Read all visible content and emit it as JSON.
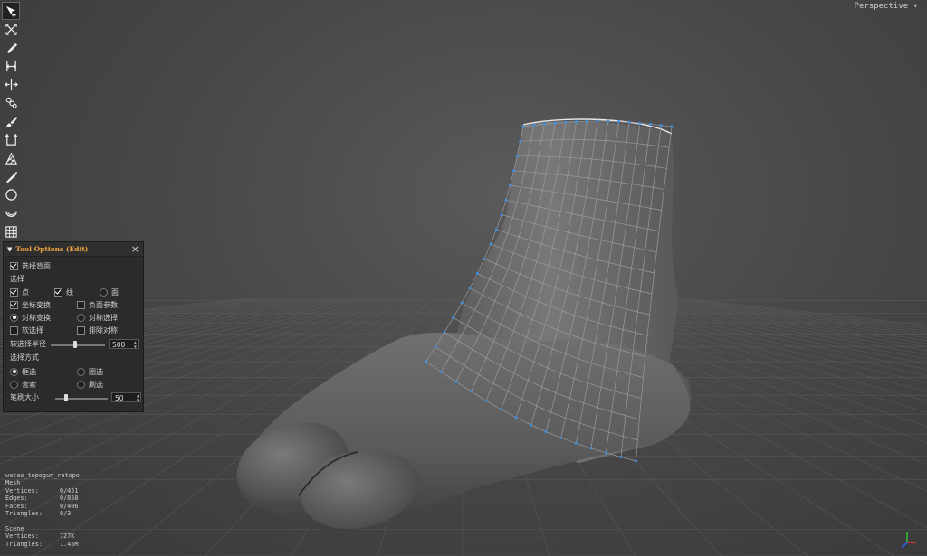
{
  "viewport": {
    "camera_label": "Perspective",
    "camera_dropdown_icon": "caret-down-icon",
    "background_colors": [
      "#5a5a5a",
      "#383838"
    ],
    "mesh_color": "#6a6a6a",
    "wire_color": "#9a9a9a",
    "vertex_color": "#3d8fe0"
  },
  "toolbar": {
    "tools": [
      {
        "name": "select-tool",
        "icon": "arrow-select-icon",
        "active": true
      },
      {
        "name": "transform-tool",
        "icon": "cross-arrows-icon"
      },
      {
        "name": "pen-tool",
        "icon": "pen-icon"
      },
      {
        "name": "bridge-tool",
        "icon": "bridge-icon"
      },
      {
        "name": "slide-tool",
        "icon": "slide-arrows-icon"
      },
      {
        "name": "loop-tool",
        "icon": "loop-rings-icon"
      },
      {
        "name": "brush-tool",
        "icon": "brush-icon"
      },
      {
        "name": "extend-tool",
        "icon": "extend-edge-icon"
      },
      {
        "name": "fill-tool",
        "icon": "fill-patch-icon"
      },
      {
        "name": "knife-tool",
        "icon": "knife-icon"
      },
      {
        "name": "circle-tool",
        "icon": "circle-icon"
      },
      {
        "name": "relax-tool",
        "icon": "cup-curve-icon"
      },
      {
        "name": "grid-tool",
        "icon": "grid-icon"
      }
    ]
  },
  "tool_options": {
    "title": "Tool Options (Edit)",
    "collapse_icon": "triangle-down-icon",
    "close_icon": "close-icon",
    "close_glyph": "×",
    "select_backface": {
      "label": "选择背面",
      "checked": true
    },
    "select_section": "选择",
    "point": {
      "label": "点",
      "checked": true
    },
    "edge": {
      "label": "线",
      "checked": true
    },
    "face": {
      "label": "面",
      "checked": false
    },
    "coord_transform": {
      "label": "坐标变换",
      "checked": true
    },
    "negative_param": {
      "label": "负面参数",
      "checked": false
    },
    "sym_transform": {
      "label": "对称变换",
      "checked": true
    },
    "sym_select": {
      "label": "对称选择",
      "checked": false
    },
    "soft_select": {
      "label": "软选择",
      "checked": false
    },
    "exclude_sym": {
      "label": "排除对称",
      "checked": false
    },
    "soft_radius": {
      "label": "软选择半径",
      "value": "500",
      "fraction": 0.45
    },
    "select_mode_section": "选择方式",
    "box_select": {
      "label": "框选",
      "checked": true
    },
    "circle_select": {
      "label": "圈选",
      "checked": false
    },
    "lasso_select": {
      "label": "套索",
      "checked": false
    },
    "brush_select": {
      "label": "刷选",
      "checked": false
    },
    "brush_size": {
      "label": "笔刷大小",
      "value": "50",
      "fraction": 0.2
    }
  },
  "stats": {
    "object_name": "watao_topogun_retopo",
    "mesh_header": "Mesh",
    "mesh": [
      {
        "label": "Vertices:",
        "value": "0/451"
      },
      {
        "label": "Edges:",
        "value": "0/858"
      },
      {
        "label": "Faces:",
        "value": "0/406"
      },
      {
        "label": "Triangles:",
        "value": "0/3"
      }
    ],
    "scene_header": "Scene",
    "scene": [
      {
        "label": "Vertices:",
        "value": "727K"
      },
      {
        "label": "Triangles:",
        "value": "1.45M"
      }
    ]
  },
  "axis_gizmo": {
    "icon": "axis-gizmo-icon",
    "colors": [
      "#ff3030",
      "#30c030",
      "#3060ff"
    ]
  }
}
